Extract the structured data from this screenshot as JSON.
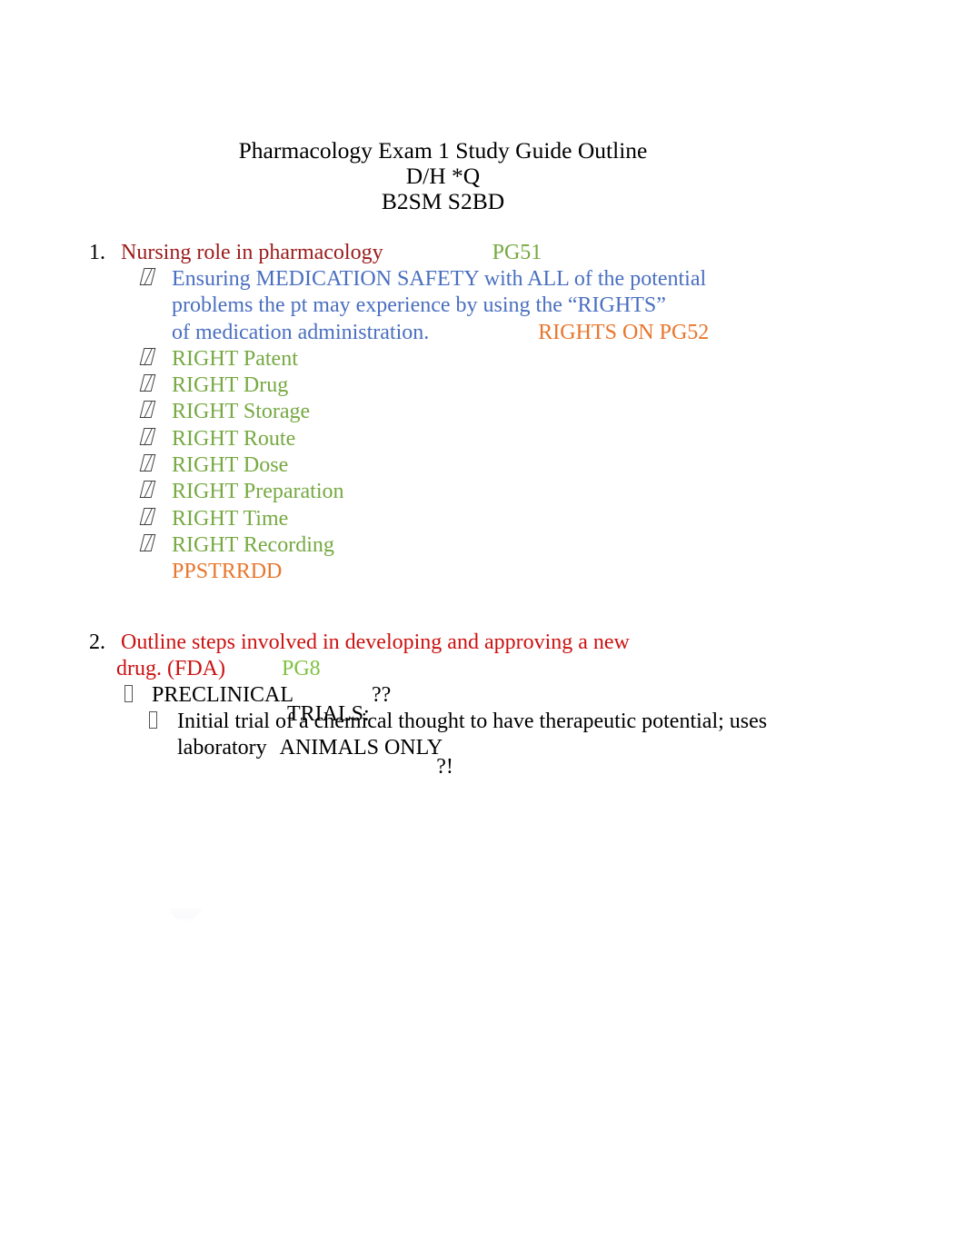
{
  "document": {
    "title_lines": [
      "Pharmacology Exam 1 Study Guide Outline",
      "D/H *Q",
      "B2SM S2BD"
    ]
  },
  "colors": {
    "red_dark": "#9C1B1B",
    "red_bright": "#CC1111",
    "green_olive": "#76A942",
    "green_bright": "#7FC242",
    "blue": "#4A6FC0",
    "orange": "#E8762C",
    "black": "#000000"
  },
  "items": [
    {
      "number": "1.",
      "heading": "Nursing role in pharmacology",
      "heading_page_ref": "PG51",
      "paragraph": {
        "line1": "Ensuring MEDICATION SAFETY with ALL of the potential",
        "line2": "problems the pt may experience by using the “RIGHTS”",
        "line3": "of medication administration.",
        "line3_ref": "RIGHTS ON PG52"
      },
      "rights": [
        "RIGHT Patent",
        "RIGHT Drug",
        "RIGHT Storage",
        "RIGHT Route",
        "RIGHT Dose",
        "RIGHT Preparation",
        "RIGHT Time",
        "RIGHT Recording"
      ],
      "mnemonic": "PPSTRRDD"
    },
    {
      "number": "2.",
      "heading_line1": "Outline steps involved in developing and approving a new",
      "heading_line2": "drug. (FDA)",
      "heading_page_ref": "PG8",
      "sub": {
        "label_a": "PRECLINICAL",
        "label_b": "TRIALS:",
        "label_q": "??",
        "detail_line1": "Initial trial of a chemical thought to have therapeutic potential; uses",
        "detail_line2_a": "laboratory",
        "detail_line2_b": "ANIMALS ONLY",
        "detail_line2_c": "?!"
      }
    }
  ]
}
